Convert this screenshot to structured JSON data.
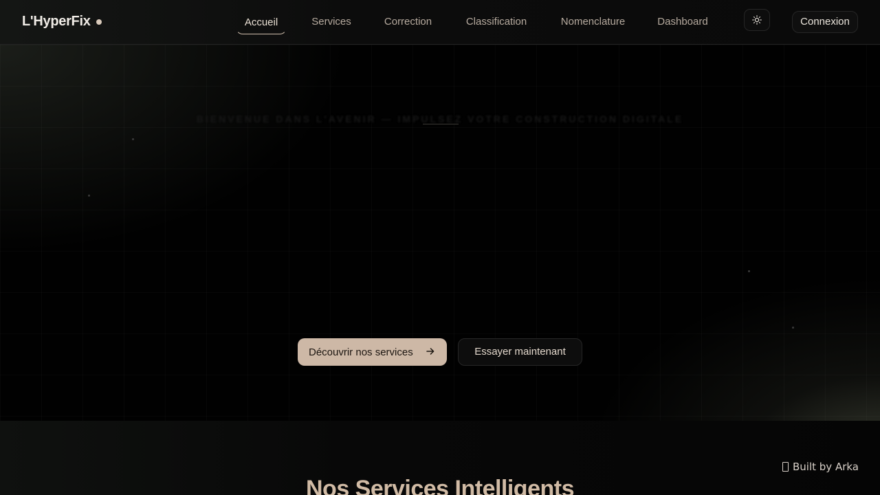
{
  "header": {
    "logo": "L'HyperFix",
    "nav": [
      {
        "label": "Accueil",
        "active": true
      },
      {
        "label": "Services",
        "active": false
      },
      {
        "label": "Correction",
        "active": false
      },
      {
        "label": "Classification",
        "active": false
      },
      {
        "label": "Nomenclature",
        "active": false
      },
      {
        "label": "Dashboard",
        "active": false
      }
    ],
    "theme_icon": "sun-icon",
    "login_label": "Connexion"
  },
  "hero": {
    "tagline": "BIENVENUE DANS L'AVENIR — IMPULSEZ VOTRE CONSTRUCTION DIGITALE",
    "primary_button": "Découvrir nos services",
    "primary_icon": "arrow-right-icon",
    "secondary_button": "Essayer maintenant"
  },
  "services": {
    "title": "Nos Services Intelligents"
  },
  "badge": {
    "label": "Built by Arka"
  },
  "colors": {
    "accent": "#cdb8a6",
    "background": "#050505",
    "nav_text": "#b7ab9f"
  }
}
